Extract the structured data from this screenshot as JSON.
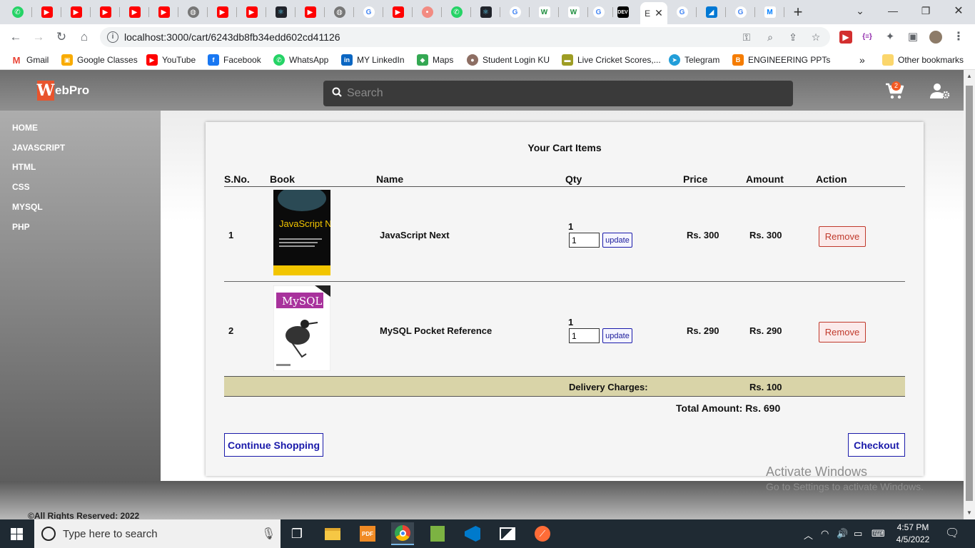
{
  "browser": {
    "active_tab_title": "E",
    "url": "localhost:3000/cart/6243db8fb34edd602cd41126",
    "bookmarks": [
      "Gmail",
      "Google Classes",
      "YouTube",
      "Facebook",
      "WhatsApp",
      "MY LinkedIn",
      "Maps",
      "Student Login KU",
      "Live Cricket Scores,...",
      "Telegram",
      "ENGINEERING PPTs",
      "Other bookmarks"
    ],
    "more_bookmarks": "»",
    "ext_code_label": "{≡}"
  },
  "site": {
    "logo_letter": "W",
    "logo_text": "ebPro",
    "search_placeholder": "Search",
    "cart_count": "2",
    "nav": [
      "HOME",
      "JAVASCRIPT",
      "HTML",
      "CSS",
      "MYSQL",
      "PHP"
    ],
    "footer": "©All Rights Reserved: 2022"
  },
  "cart": {
    "title": "Your Cart Items",
    "headers": {
      "sno": "S.No.",
      "book": "Book",
      "name": "Name",
      "qty": "Qty",
      "price": "Price",
      "amount": "Amount",
      "action": "Action"
    },
    "items": [
      {
        "sno": "1",
        "name": "JavaScript Next",
        "qty": "1",
        "qty_value": "1",
        "price": "Rs. 300",
        "amount": "Rs. 300",
        "update": "update",
        "remove": "Remove",
        "cover_title": "JavaScript Next"
      },
      {
        "sno": "2",
        "name": "MySQL Pocket Reference",
        "qty": "1",
        "qty_value": "1",
        "price": "Rs. 290",
        "amount": "Rs. 290",
        "update": "update",
        "remove": "Remove",
        "cover_title": "MySQL"
      }
    ],
    "delivery_label": "Delivery Charges:",
    "delivery_amount": "Rs. 100",
    "total": "Total Amount: Rs. 690",
    "continue_label": "Continue Shopping",
    "checkout_label": "Checkout"
  },
  "watermark": {
    "line1": "Activate Windows",
    "line2": "Go to Settings to activate Windows."
  },
  "taskbar": {
    "search_placeholder": "Type here to search",
    "time": "4:57 PM",
    "date": "4/5/2022"
  }
}
